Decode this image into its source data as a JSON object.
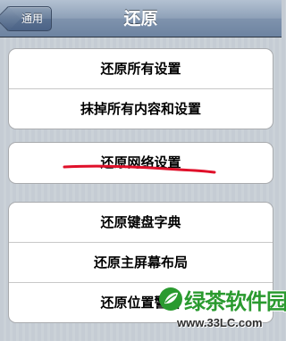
{
  "navbar": {
    "back_label": "通用",
    "title": "还原"
  },
  "groups": [
    {
      "items": [
        {
          "label": "还原所有设置"
        },
        {
          "label": "抹掉所有内容和设置"
        }
      ]
    },
    {
      "items": [
        {
          "label": "还原网络设置"
        }
      ]
    },
    {
      "items": [
        {
          "label": "还原键盘字典"
        },
        {
          "label": "还原主屏幕布局"
        },
        {
          "label": "还原位置警告"
        }
      ]
    }
  ],
  "annotation": {
    "color": "#e0102a"
  },
  "watermark": {
    "name": "绿茶软件园",
    "url": "www.33LC.com",
    "color": "#2a9a2f"
  }
}
